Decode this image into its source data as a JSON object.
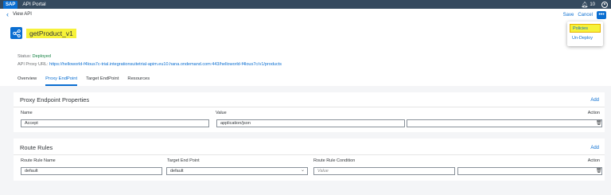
{
  "shell": {
    "logo": "SAP",
    "title": "API Portal",
    "notification_count": "10"
  },
  "header": {
    "back_glyph": "‹",
    "breadcrumb": "View API",
    "save_label": "Save",
    "cancel_label": "Cancel",
    "more_glyph": "•••",
    "api_name": "getProduct_v1",
    "status_label": "Status:",
    "status_value": "Deployed",
    "url_label": "API Proxy URL:",
    "url_value": "https://helloworld-f4lous7c-trial.integrationsuitetrial-apim.eu10.hana.ondemand.com:443/helloworld-f4lous7c/v1/products"
  },
  "tabs": [
    {
      "label": "Overview"
    },
    {
      "label": "Proxy EndPoint"
    },
    {
      "label": "Target EndPoint"
    },
    {
      "label": "Resources"
    }
  ],
  "proxy_section": {
    "title": "Proxy Endpoint Properties",
    "add_label": "Add",
    "columns": {
      "name": "Name",
      "value": "Value",
      "action": "Action"
    },
    "row": {
      "name": "Accept",
      "value": "application/json"
    }
  },
  "route_section": {
    "title": "Route Rules",
    "add_label": "Add",
    "columns": {
      "rule_name": "Route Rule Name",
      "target": "Target End Point",
      "condition": "Route Rule Condition",
      "action": "Action"
    },
    "row": {
      "rule_name": "default",
      "target": "default",
      "condition_placeholder": "Value"
    }
  },
  "menu": {
    "items": [
      {
        "label": "Policies"
      },
      {
        "label": "Un-Deploy"
      }
    ]
  },
  "colors": {
    "shell": "#354a5f",
    "accent": "#0a6ed1",
    "highlight": "#f6f23a",
    "status_ok": "#107e3e"
  },
  "icons": {
    "api_icon": "share-nodes-icon",
    "bell": "bell-icon",
    "user": "user-avatar-icon",
    "trash": "trash-icon",
    "dropdown": "chevron-down-icon"
  }
}
